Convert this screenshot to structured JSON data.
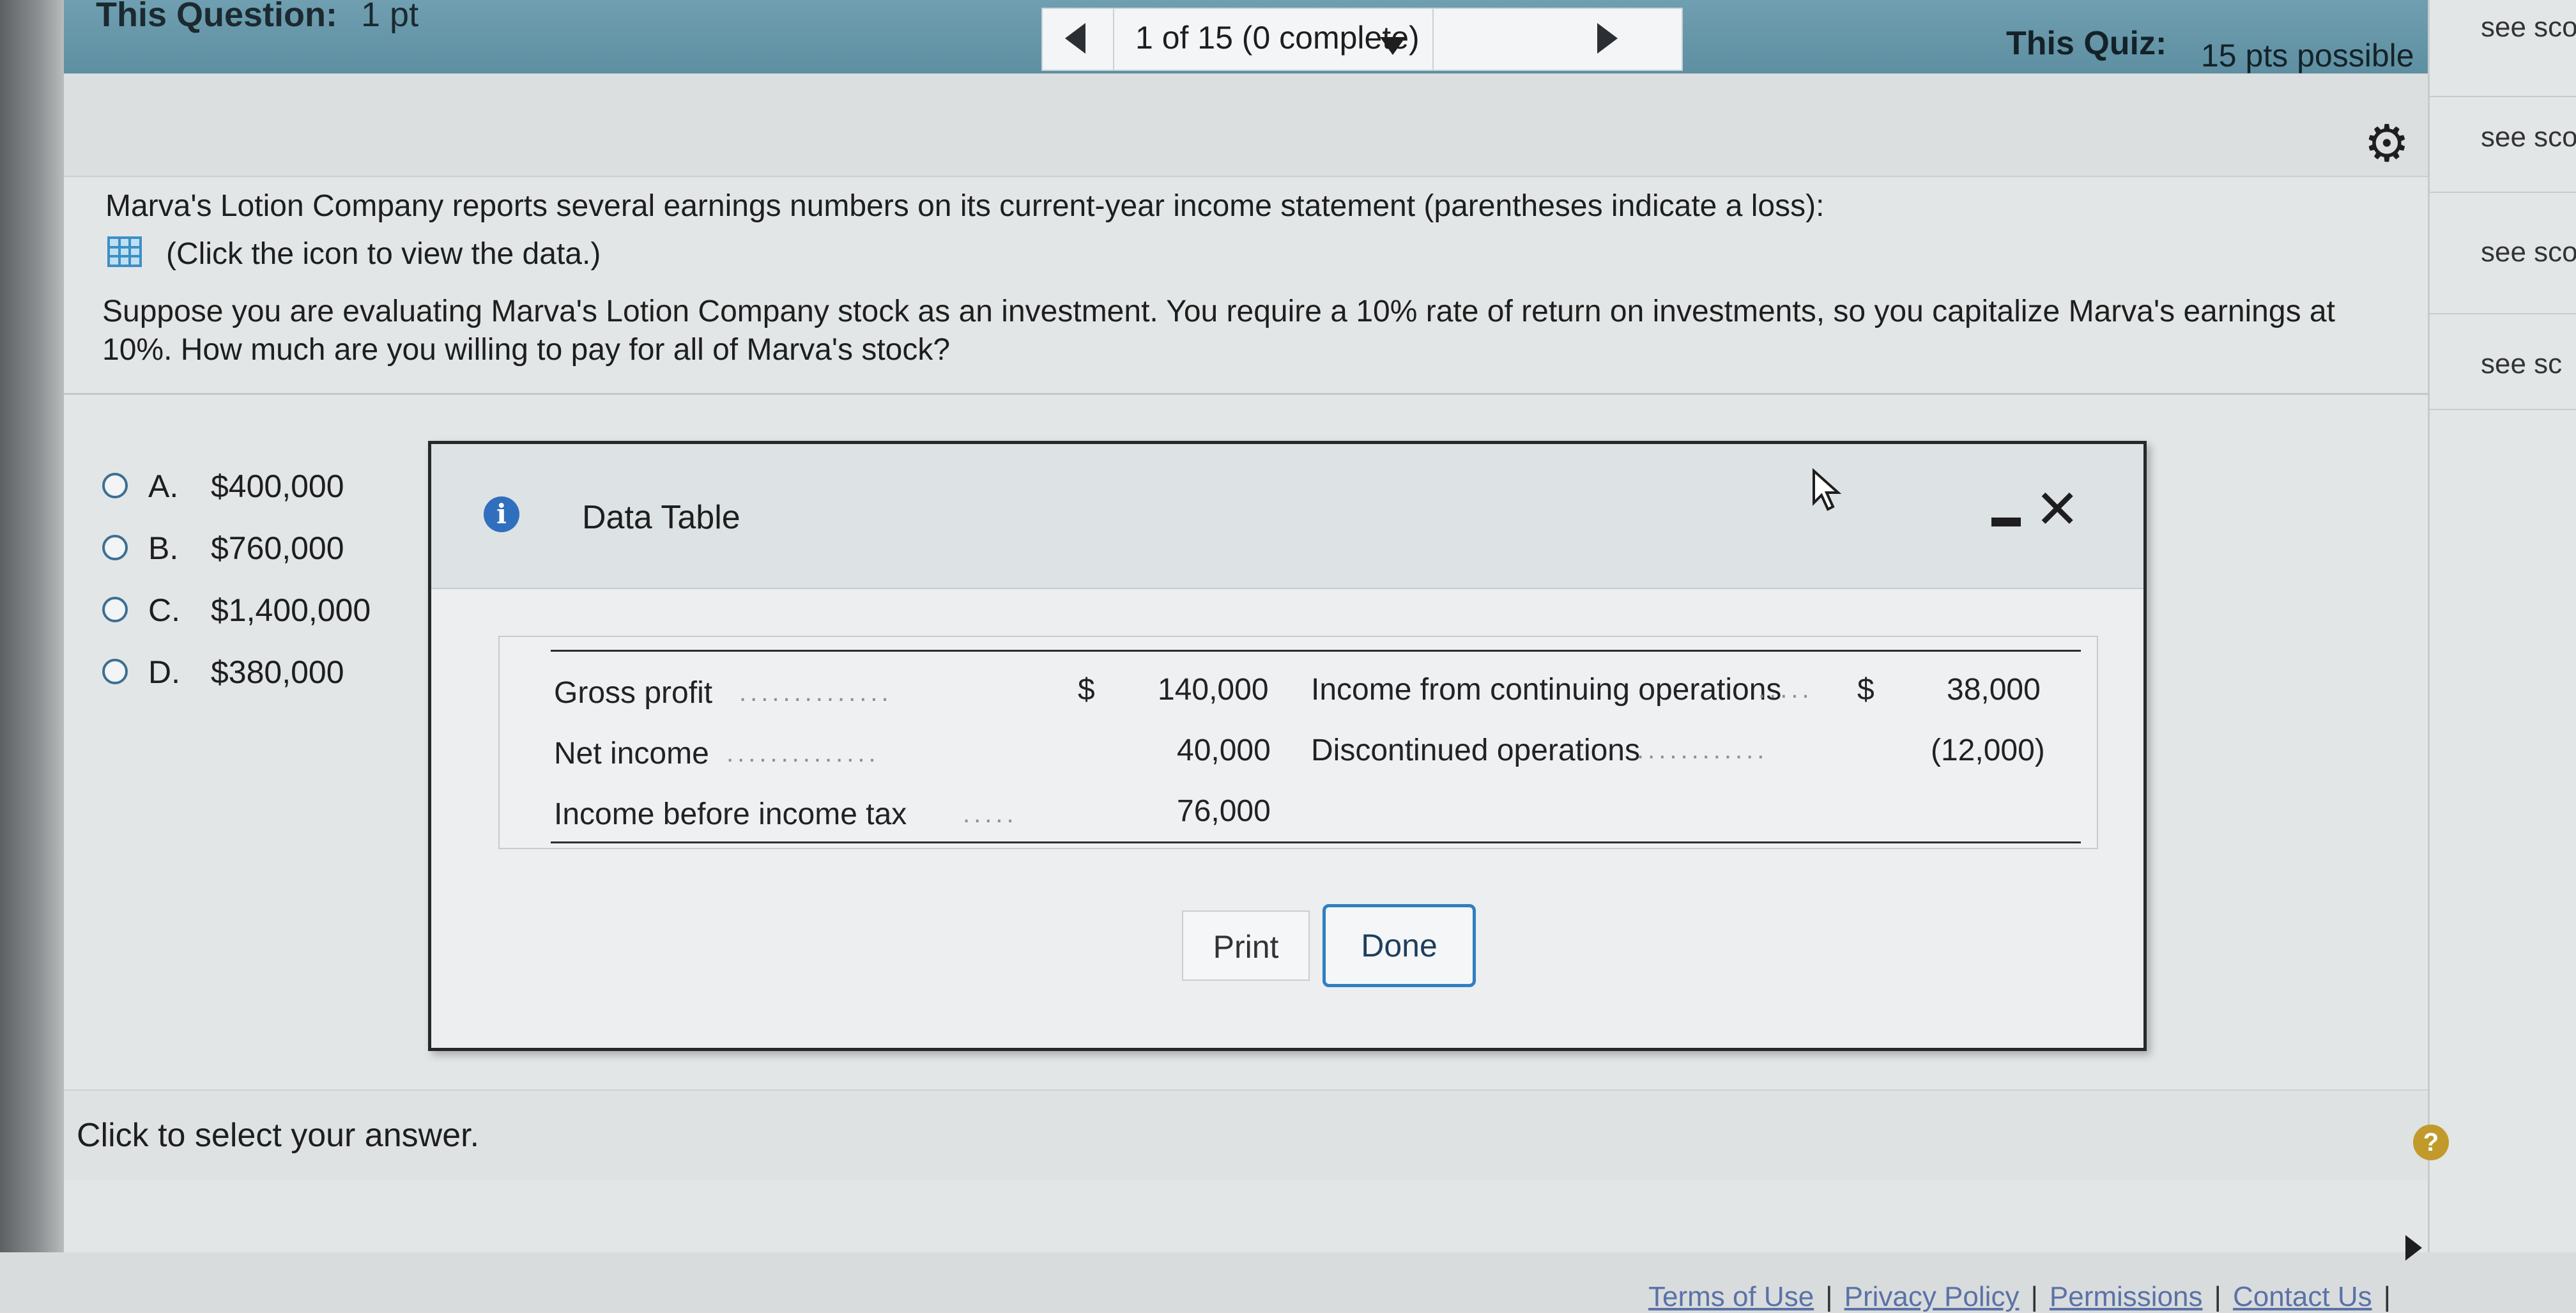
{
  "header": {
    "question_label": "This Question:",
    "question_points": "1 pt",
    "progress": "1 of 15 (0 complete)",
    "quiz_label": "This Quiz:",
    "quiz_points": "15 pts possible"
  },
  "right_panel": {
    "items": [
      "see sco",
      "see sco",
      "see sco",
      "see sc"
    ]
  },
  "question": {
    "intro": "Marva's Lotion Company reports several earnings numbers on its current-year income statement (parentheses indicate a loss):",
    "data_link": "(Click the icon to view the data.)",
    "prompt_line1": "Suppose you are evaluating Marva's Lotion Company stock as an investment. You require a 10% rate of return on investments, so you capitalize Marva's earnings at",
    "prompt_line2": "10%. How much are you willing to pay for all of Marva's stock?"
  },
  "options": [
    {
      "letter": "A.",
      "value": "$400,000"
    },
    {
      "letter": "B.",
      "value": "$760,000"
    },
    {
      "letter": "C.",
      "value": "$1,400,000"
    },
    {
      "letter": "D.",
      "value": "$380,000"
    }
  ],
  "bottom": {
    "hint": "Click to select your answer."
  },
  "footer": {
    "terms": "Terms of Use",
    "privacy": "Privacy Policy",
    "permissions": "Permissions",
    "contact": "Contact Us"
  },
  "dialog": {
    "title": "Data Table",
    "print_label": "Print",
    "done_label": "Done",
    "table": {
      "left": [
        {
          "label": "Gross profit",
          "currency": "$",
          "value": "140,000"
        },
        {
          "label": "Net income",
          "currency": "",
          "value": "40,000"
        },
        {
          "label": "Income before income tax",
          "currency": "",
          "value": "76,000"
        }
      ],
      "right": [
        {
          "label": "Income from continuing operations",
          "currency": "$",
          "value": "38,000"
        },
        {
          "label": "Discontinued operations",
          "currency": "",
          "value": "(12,000)"
        }
      ]
    }
  },
  "colors": {
    "header": "#5e8fa2",
    "radio": "#3c6f93",
    "done_border": "#2f7fc2",
    "info_icon": "#2f6fbe",
    "help_icon": "#c19a2b"
  },
  "icons": [
    "gear-icon",
    "grid-data-icon",
    "info-icon",
    "cursor-icon",
    "close-icon",
    "help-icon"
  ]
}
